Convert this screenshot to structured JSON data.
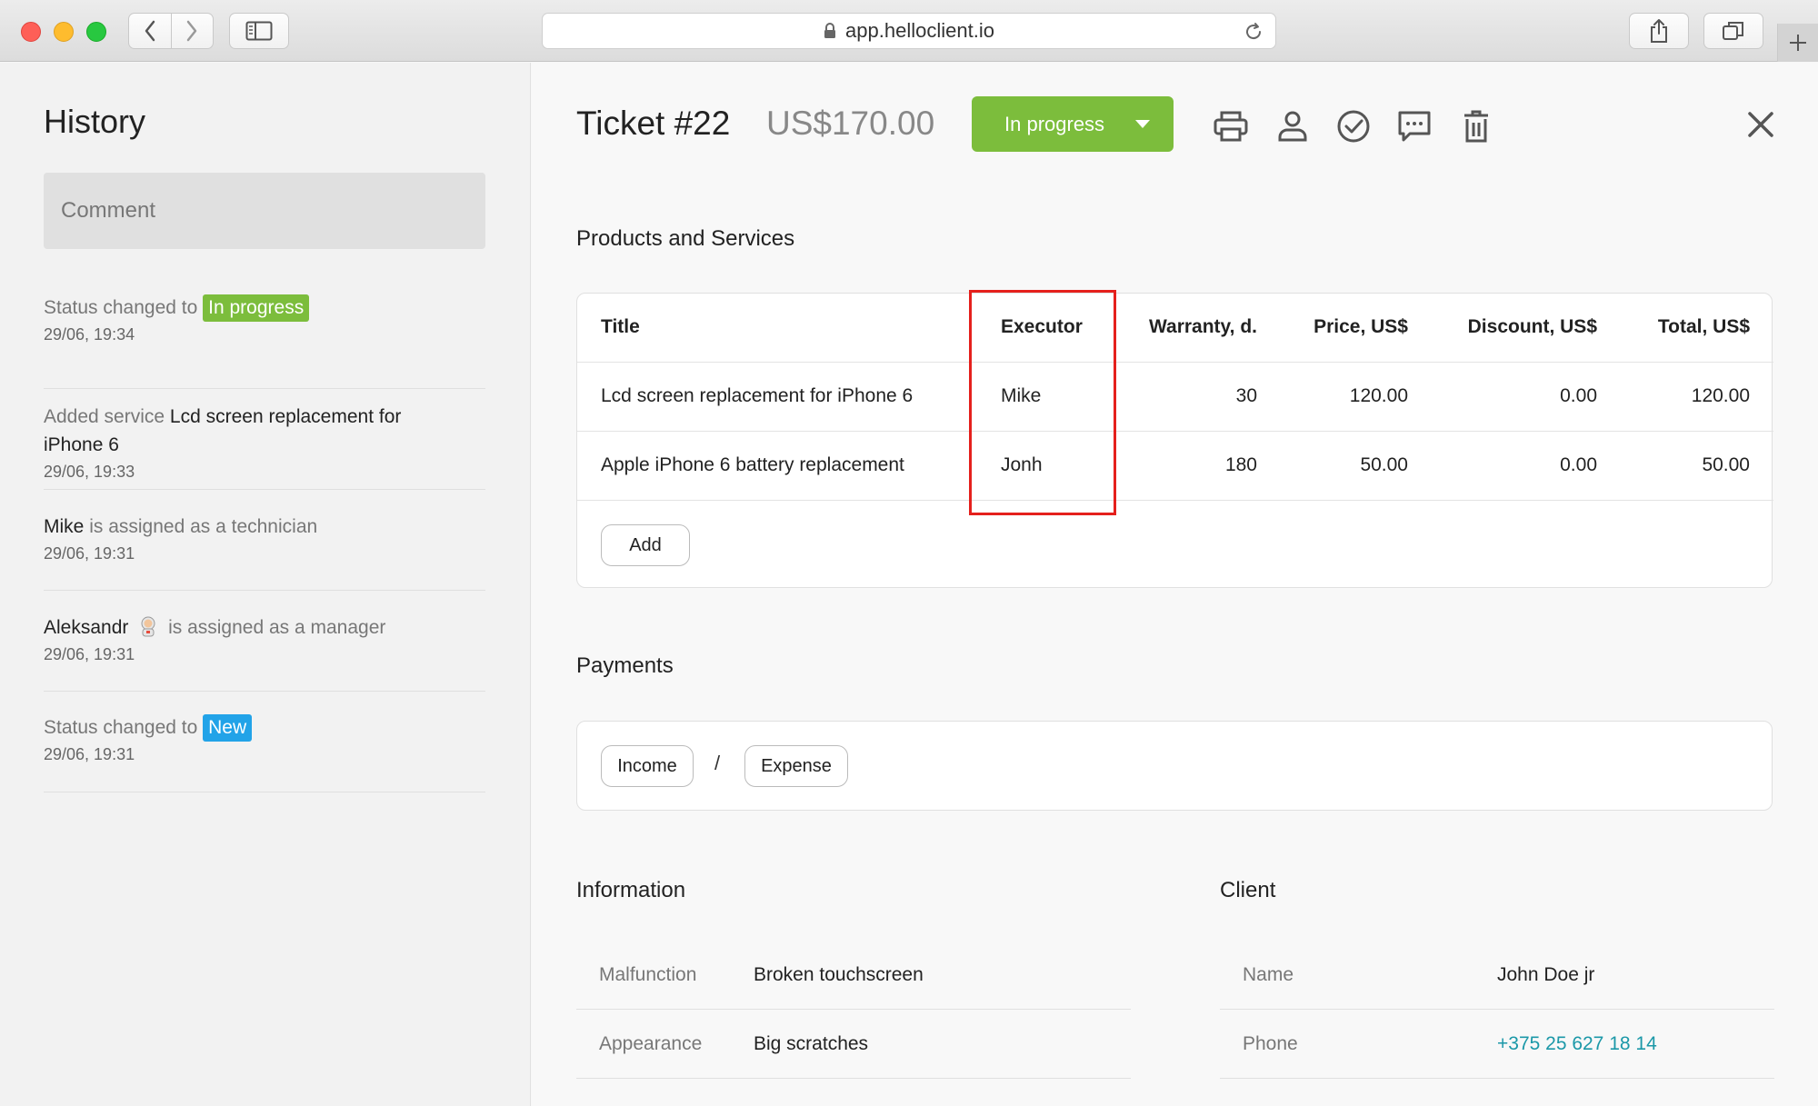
{
  "browser": {
    "url": "app.helloclient.io"
  },
  "history": {
    "title": "History",
    "comment_placeholder": "Comment",
    "items": [
      {
        "pre": "Status changed to",
        "badge": "In progress",
        "time": "29/06, 19:34"
      },
      {
        "pre": "Added service",
        "strong": "Lcd screen replacement for",
        "strong2": "iPhone 6",
        "time": "29/06, 19:33"
      },
      {
        "strong": "Mike",
        "post": "is assigned as a technician",
        "time": "29/06, 19:31"
      },
      {
        "strong": "Aleksandr",
        "post": "is assigned as a manager",
        "time": "29/06, 19:31"
      },
      {
        "pre": "Status changed to",
        "badge": "New",
        "time": "29/06, 19:31"
      }
    ]
  },
  "ticket": {
    "title": "Ticket #22",
    "price": "US$170.00",
    "status": "In progress",
    "status_color": "#7cbd3c",
    "toolbar_icons": [
      "print-icon",
      "user-icon",
      "check-circle-icon",
      "comment-icon",
      "trash-icon"
    ]
  },
  "products": {
    "title": "Products and Services",
    "headers": [
      "Title",
      "Executor",
      "Warranty, d.",
      "Price, US$",
      "Discount, US$",
      "Total, US$"
    ],
    "rows": [
      [
        "Lcd screen replacement for iPhone 6",
        "Mike",
        "30",
        "120.00",
        "0.00",
        "120.00"
      ],
      [
        "Apple iPhone 6 battery replacement",
        "Jonh",
        "180",
        "50.00",
        "0.00",
        "50.00"
      ]
    ],
    "add_label": "Add"
  },
  "payments": {
    "title": "Payments",
    "income_label": "Income",
    "separator": "/",
    "expense_label": "Expense"
  },
  "information": {
    "title": "Information",
    "rows": [
      {
        "key": "Malfunction",
        "value": "Broken touchscreen"
      },
      {
        "key": "Appearance",
        "value": "Big scratches"
      }
    ]
  },
  "client": {
    "title": "Client",
    "rows": [
      {
        "key": "Name",
        "value": "John Doe jr"
      },
      {
        "key": "Phone",
        "value": "+375 25 627 18 14"
      }
    ]
  }
}
